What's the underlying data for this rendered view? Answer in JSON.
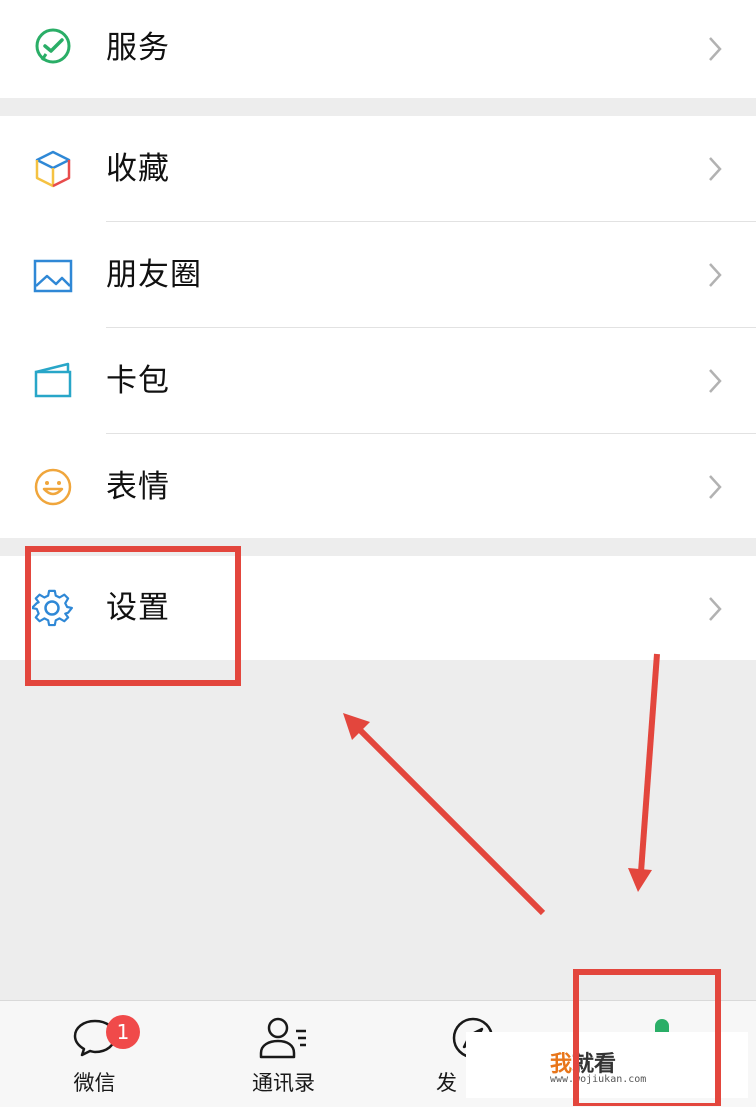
{
  "menu": {
    "services": {
      "label": "服务",
      "icon": "wechat-pay-icon"
    },
    "favorites": {
      "label": "收藏",
      "icon": "cube-icon"
    },
    "moments": {
      "label": "朋友圈",
      "icon": "image-icon"
    },
    "cards": {
      "label": "卡包",
      "icon": "wallet-icon"
    },
    "stickers": {
      "label": "表情",
      "icon": "smiley-icon"
    },
    "settings": {
      "label": "设置",
      "icon": "gear-icon"
    }
  },
  "tabbar": {
    "chats": {
      "label": "微信",
      "badge": "1"
    },
    "contacts": {
      "label": "通讯录"
    },
    "discover": {
      "label": "发"
    }
  },
  "watermark": {
    "wo": "我",
    "rest": "就看",
    "url": "www.wojiukan.com"
  },
  "colors": {
    "annotation": "#e3463d",
    "green": "#2aae67",
    "blue": "#2f88d6"
  }
}
